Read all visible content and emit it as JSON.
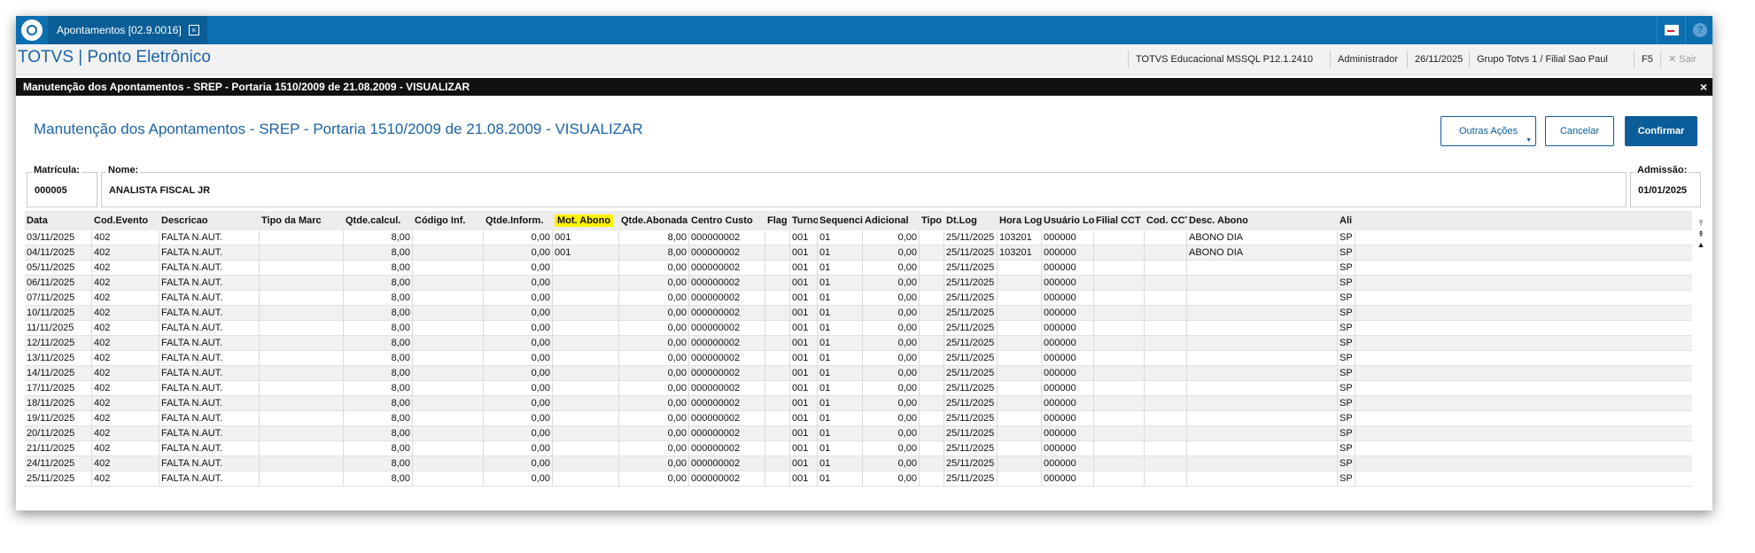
{
  "topbar": {
    "tab_label": "Apontamentos [02.9.0016]",
    "tab_close": "×",
    "help": "?"
  },
  "appbar": {
    "title": "TOTVS | Ponto Eletrônico",
    "environment": "TOTVS Educacional MSSQL P12.1.2410",
    "user": "Administrador",
    "date": "26/11/2025",
    "company": "Grupo Totvs 1 / Filial Sao Paul",
    "f5": "F5",
    "sair": "✕  Sair"
  },
  "dialog": {
    "bar_title": "Manutenção dos Apontamentos - SREP - Portaria 1510/2009 de 21.08.2009 - VISUALIZAR",
    "close": "×",
    "title": "Manutenção dos Apontamentos - SREP - Portaria 1510/2009 de 21.08.2009 - VISUALIZAR",
    "buttons": {
      "outras": "Outras Ações",
      "cancelar": "Cancelar",
      "confirmar": "Confirmar"
    }
  },
  "fields": {
    "matricula_label": "Matrícula:",
    "matricula": "000005",
    "nome_label": "Nome:",
    "nome": "ANALISTA FISCAL JR",
    "admissao_label": "Admissão:",
    "admissao": "01/01/2025"
  },
  "grid": {
    "headers": [
      "Data",
      "Cod.Evento",
      "Descricao",
      "Tipo da Marc",
      "Qtde.calcul.",
      "Código Inf.",
      "Qtde.Inform.",
      "Mot. Abono",
      "Qtde.Abonada",
      "Centro Custo",
      "Flag",
      "Turno",
      "Sequencia",
      "Adicional",
      "Tipo",
      "Dt.Log",
      "Hora Log",
      "Usuário Log",
      "Filial CCT",
      "Cod. CCT",
      "Desc. Abono",
      "Ali"
    ],
    "rows": [
      [
        "03/11/2025",
        "402",
        "FALTA N.AUT.",
        "",
        "8,00",
        "",
        "0,00",
        "001",
        "8,00",
        "000000002",
        "",
        "001",
        "01",
        "0,00",
        "",
        "25/11/2025",
        "103201",
        "000000",
        "",
        "",
        "ABONO DIA",
        "SP"
      ],
      [
        "04/11/2025",
        "402",
        "FALTA N.AUT.",
        "",
        "8,00",
        "",
        "0,00",
        "001",
        "8,00",
        "000000002",
        "",
        "001",
        "01",
        "0,00",
        "",
        "25/11/2025",
        "103201",
        "000000",
        "",
        "",
        "ABONO DIA",
        "SP"
      ],
      [
        "05/11/2025",
        "402",
        "FALTA N.AUT.",
        "",
        "8,00",
        "",
        "0,00",
        "",
        "0,00",
        "000000002",
        "",
        "001",
        "01",
        "0,00",
        "",
        "25/11/2025",
        "",
        "000000",
        "",
        "",
        "",
        "SP"
      ],
      [
        "06/11/2025",
        "402",
        "FALTA N.AUT.",
        "",
        "8,00",
        "",
        "0,00",
        "",
        "0,00",
        "000000002",
        "",
        "001",
        "01",
        "0,00",
        "",
        "25/11/2025",
        "",
        "000000",
        "",
        "",
        "",
        "SP"
      ],
      [
        "07/11/2025",
        "402",
        "FALTA N.AUT.",
        "",
        "8,00",
        "",
        "0,00",
        "",
        "0,00",
        "000000002",
        "",
        "001",
        "01",
        "0,00",
        "",
        "25/11/2025",
        "",
        "000000",
        "",
        "",
        "",
        "SP"
      ],
      [
        "10/11/2025",
        "402",
        "FALTA N.AUT.",
        "",
        "8,00",
        "",
        "0,00",
        "",
        "0,00",
        "000000002",
        "",
        "001",
        "01",
        "0,00",
        "",
        "25/11/2025",
        "",
        "000000",
        "",
        "",
        "",
        "SP"
      ],
      [
        "11/11/2025",
        "402",
        "FALTA N.AUT.",
        "",
        "8,00",
        "",
        "0,00",
        "",
        "0,00",
        "000000002",
        "",
        "001",
        "01",
        "0,00",
        "",
        "25/11/2025",
        "",
        "000000",
        "",
        "",
        "",
        "SP"
      ],
      [
        "12/11/2025",
        "402",
        "FALTA N.AUT.",
        "",
        "8,00",
        "",
        "0,00",
        "",
        "0,00",
        "000000002",
        "",
        "001",
        "01",
        "0,00",
        "",
        "25/11/2025",
        "",
        "000000",
        "",
        "",
        "",
        "SP"
      ],
      [
        "13/11/2025",
        "402",
        "FALTA N.AUT.",
        "",
        "8,00",
        "",
        "0,00",
        "",
        "0,00",
        "000000002",
        "",
        "001",
        "01",
        "0,00",
        "",
        "25/11/2025",
        "",
        "000000",
        "",
        "",
        "",
        "SP"
      ],
      [
        "14/11/2025",
        "402",
        "FALTA N.AUT.",
        "",
        "8,00",
        "",
        "0,00",
        "",
        "0,00",
        "000000002",
        "",
        "001",
        "01",
        "0,00",
        "",
        "25/11/2025",
        "",
        "000000",
        "",
        "",
        "",
        "SP"
      ],
      [
        "17/11/2025",
        "402",
        "FALTA N.AUT.",
        "",
        "8,00",
        "",
        "0,00",
        "",
        "0,00",
        "000000002",
        "",
        "001",
        "01",
        "0,00",
        "",
        "25/11/2025",
        "",
        "000000",
        "",
        "",
        "",
        "SP"
      ],
      [
        "18/11/2025",
        "402",
        "FALTA N.AUT.",
        "",
        "8,00",
        "",
        "0,00",
        "",
        "0,00",
        "000000002",
        "",
        "001",
        "01",
        "0,00",
        "",
        "25/11/2025",
        "",
        "000000",
        "",
        "",
        "",
        "SP"
      ],
      [
        "19/11/2025",
        "402",
        "FALTA N.AUT.",
        "",
        "8,00",
        "",
        "0,00",
        "",
        "0,00",
        "000000002",
        "",
        "001",
        "01",
        "0,00",
        "",
        "25/11/2025",
        "",
        "000000",
        "",
        "",
        "",
        "SP"
      ],
      [
        "20/11/2025",
        "402",
        "FALTA N.AUT.",
        "",
        "8,00",
        "",
        "0,00",
        "",
        "0,00",
        "000000002",
        "",
        "001",
        "01",
        "0,00",
        "",
        "25/11/2025",
        "",
        "000000",
        "",
        "",
        "",
        "SP"
      ],
      [
        "21/11/2025",
        "402",
        "FALTA N.AUT.",
        "",
        "8,00",
        "",
        "0,00",
        "",
        "0,00",
        "000000002",
        "",
        "001",
        "01",
        "0,00",
        "",
        "25/11/2025",
        "",
        "000000",
        "",
        "",
        "",
        "SP"
      ],
      [
        "24/11/2025",
        "402",
        "FALTA N.AUT.",
        "",
        "8,00",
        "",
        "0,00",
        "",
        "0,00",
        "000000002",
        "",
        "001",
        "01",
        "0,00",
        "",
        "25/11/2025",
        "",
        "000000",
        "",
        "",
        "",
        "SP"
      ],
      [
        "25/11/2025",
        "402",
        "FALTA N.AUT.",
        "",
        "8,00",
        "",
        "0,00",
        "",
        "0,00",
        "000000002",
        "",
        "001",
        "01",
        "0,00",
        "",
        "25/11/2025",
        "",
        "000000",
        "",
        "",
        "",
        "SP"
      ]
    ]
  },
  "colors": {
    "brand_blue": "#0b6fb0",
    "highlight": "#fff200",
    "dialog_bar": "#111111"
  },
  "icons": [
    "totvs-logo-icon",
    "close-icon",
    "mail-icon",
    "help-icon",
    "scroll-top-icon",
    "scroll-up-icon",
    "scroll-page-up-icon"
  ]
}
